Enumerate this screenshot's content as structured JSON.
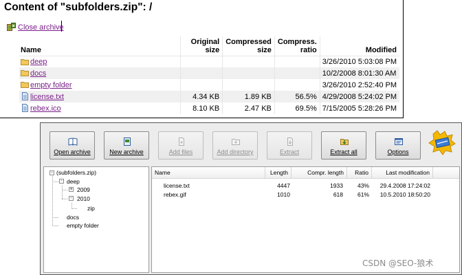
{
  "web": {
    "title": "Content of \"subfolders.zip\": /",
    "close_archive": "Close archive",
    "table": {
      "headers": {
        "name": "Name",
        "original_size": "Original size",
        "compressed_size": "Compressed size",
        "ratio": "Compress. ratio",
        "modified": "Modified"
      },
      "rows": [
        {
          "name": "deep",
          "type": "folder",
          "original": "",
          "compressed": "",
          "ratio": "",
          "modified": "3/26/2010 5:03:08 PM"
        },
        {
          "name": "docs",
          "type": "folder",
          "original": "",
          "compressed": "",
          "ratio": "",
          "modified": "10/2/2008 8:01:30 AM"
        },
        {
          "name": "empty folder",
          "type": "folder",
          "original": "",
          "compressed": "",
          "ratio": "",
          "modified": "3/26/2010 2:52:40 PM"
        },
        {
          "name": "license.txt",
          "type": "file",
          "original": "4.34 KB",
          "compressed": "1.89 KB",
          "ratio": "56.5%",
          "modified": "4/29/2008 5:24:02 PM"
        },
        {
          "name": "rebex.ico",
          "type": "file",
          "original": "8.10 KB",
          "compressed": "2.47 KB",
          "ratio": "69.5%",
          "modified": "7/15/2005 5:28:26 PM"
        }
      ]
    }
  },
  "app": {
    "toolbar": {
      "open_archive": "Open archive",
      "new_archive": "New archive",
      "add_files": "Add files",
      "add_directory": "Add directory",
      "extract": "Extract",
      "extract_all": "Extract all",
      "options": "Options"
    },
    "tree": {
      "root": "(subfolders.zip)",
      "deep": "deep",
      "y2009": "2009",
      "y2010": "2010",
      "zip": "zip",
      "docs": "docs",
      "empty_folder": "empty folder"
    },
    "list": {
      "headers": {
        "name": "Name",
        "length": "Length",
        "compr_length": "Compr. length",
        "ratio": "Ratio",
        "last_modification": "Last modification"
      },
      "rows": [
        {
          "name": "license.txt",
          "length": "4447",
          "compr_length": "1933",
          "ratio": "43%",
          "modified": "29.4.2008 17:24:02"
        },
        {
          "name": "rebex.gif",
          "length": "1010",
          "compr_length": "618",
          "ratio": "61%",
          "modified": "10.5.2010 18:50:20"
        }
      ]
    }
  },
  "watermark": "CSDN @SEO-狼术",
  "colors": {
    "link": "#7a1f8a",
    "folder": "#f2c75c",
    "row_shade": "#f0f0f0",
    "app_bg": "#ececec"
  },
  "icons": [
    "close-archive-icon",
    "folder-icon",
    "file-icon",
    "open-archive-icon",
    "new-archive-icon",
    "add-files-icon",
    "add-directory-icon",
    "extract-icon",
    "extract-all-icon",
    "options-icon",
    "app-logo-icon"
  ]
}
